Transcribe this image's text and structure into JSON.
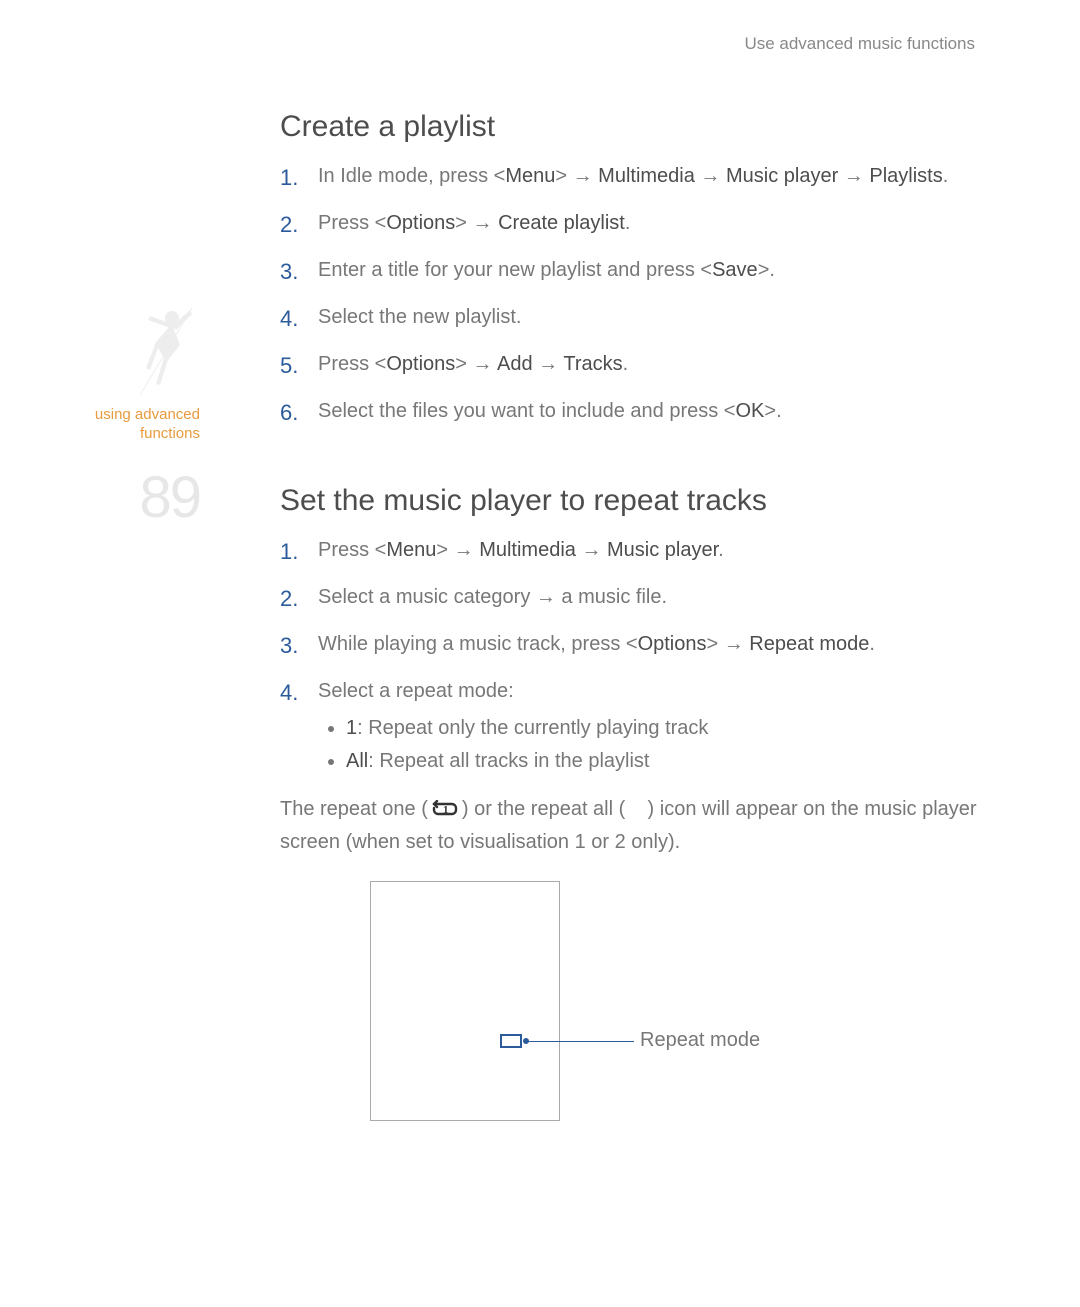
{
  "header": {
    "breadcrumb": "Use advanced music functions"
  },
  "sidebar": {
    "label": "using advanced functions",
    "page_number": "89"
  },
  "section1": {
    "title": "Create a playlist",
    "steps": [
      {
        "pre": "In Idle mode, press <",
        "b1": "Menu",
        "mid1": "> → ",
        "b2": "Multimedia",
        "mid2": " → ",
        "b3": "Music player",
        "mid3": " → ",
        "b4": "Playlists",
        "post": "."
      },
      {
        "pre": "Press <",
        "b1": "Options",
        "mid1": "> → ",
        "b2": "Create playlist",
        "post": "."
      },
      {
        "pre": "Enter a title for your new playlist and press <",
        "b1": "Save",
        "post": ">."
      },
      {
        "pre": "Select the new playlist."
      },
      {
        "pre": "Press <",
        "b1": "Options",
        "mid1": "> → ",
        "b2": "Add",
        "mid2": " → ",
        "b3": "Tracks",
        "post": "."
      },
      {
        "pre": "Select the files you want to include and press <",
        "b1": "OK",
        "post": ">."
      }
    ]
  },
  "section2": {
    "title": "Set the music player to repeat tracks",
    "steps": [
      {
        "pre": "Press <",
        "b1": "Menu",
        "mid1": "> → ",
        "b2": "Multimedia",
        "mid2": " → ",
        "b3": "Music player",
        "post": "."
      },
      {
        "pre": "Select a music category → a music file."
      },
      {
        "pre": "While playing a music track, press <",
        "b1": "Options",
        "mid1": "> → ",
        "b2": "Repeat mode",
        "post": "."
      },
      {
        "pre": "Select a repeat mode:",
        "sub": [
          {
            "b": "1",
            "rest": ": Repeat only the currently playing track"
          },
          {
            "b": "All",
            "rest": ": Repeat all tracks in the playlist"
          }
        ]
      }
    ],
    "note_part1": "The repeat one (",
    "note_part2": ") or the repeat all (",
    "note_part3": ") icon will appear on the music player screen (when set to visualisation 1 or 2 only).",
    "callout": "Repeat mode"
  }
}
